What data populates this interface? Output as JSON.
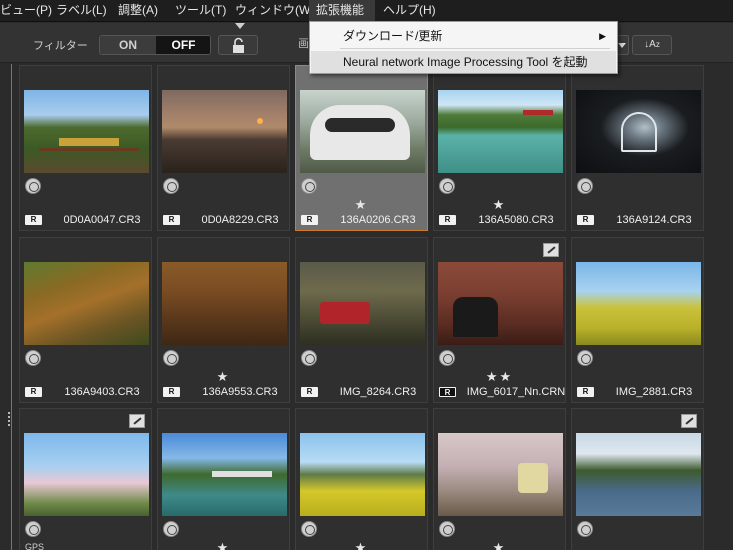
{
  "menu": {
    "items": [
      {
        "label": "ビュー(P)"
      },
      {
        "label": "ラベル(L)"
      },
      {
        "label": "調整(A)"
      },
      {
        "label": "ツール(T)"
      },
      {
        "label": "ウィンドウ(W)"
      },
      {
        "label": "拡張機能"
      },
      {
        "label": "ヘルプ(H)"
      }
    ],
    "dropdown": {
      "items": [
        {
          "label": "ダウンロード/更新"
        },
        {
          "label": "Neural network Image Processing Tool を起動"
        }
      ]
    }
  },
  "toolbar": {
    "filter_label": "フィルター",
    "toggle_on": "ON",
    "toggle_off": "OFF",
    "partial_char": "画",
    "sort_label": "↓A",
    "sort_sub": "z"
  },
  "grid": {
    "items": [
      {
        "filename": "0D0A0047.CR3",
        "raw": "R",
        "stars": "",
        "selected": false
      },
      {
        "filename": "0D0A8229.CR3",
        "raw": "R",
        "stars": "",
        "selected": false
      },
      {
        "filename": "136A0206.CR3",
        "raw": "R",
        "stars": "★",
        "selected": true
      },
      {
        "filename": "136A5080.CR3",
        "raw": "R",
        "stars": "★",
        "selected": false
      },
      {
        "filename": "136A9124.CR3",
        "raw": "R",
        "stars": "",
        "selected": false
      },
      {
        "filename": "136A9403.CR3",
        "raw": "R",
        "stars": "",
        "selected": false
      },
      {
        "filename": "136A9553.CR3",
        "raw": "R",
        "stars": "★",
        "selected": false
      },
      {
        "filename": "IMG_8264.CR3",
        "raw": "R",
        "stars": "",
        "selected": false
      },
      {
        "filename": "IMG_6017_Nn.CRN",
        "raw": "R",
        "stars": "★★",
        "selected": false
      },
      {
        "filename": "IMG_2881.CR3",
        "raw": "R",
        "stars": "",
        "selected": false
      },
      {
        "filename": "",
        "raw": "",
        "stars": "",
        "gps": "GPS",
        "selected": false
      },
      {
        "filename": "",
        "raw": "",
        "stars": "★",
        "selected": false
      },
      {
        "filename": "",
        "raw": "",
        "stars": "★",
        "selected": false
      },
      {
        "filename": "",
        "raw": "",
        "stars": "★",
        "selected": false
      },
      {
        "filename": "",
        "raw": "",
        "stars": "",
        "selected": false
      }
    ]
  }
}
